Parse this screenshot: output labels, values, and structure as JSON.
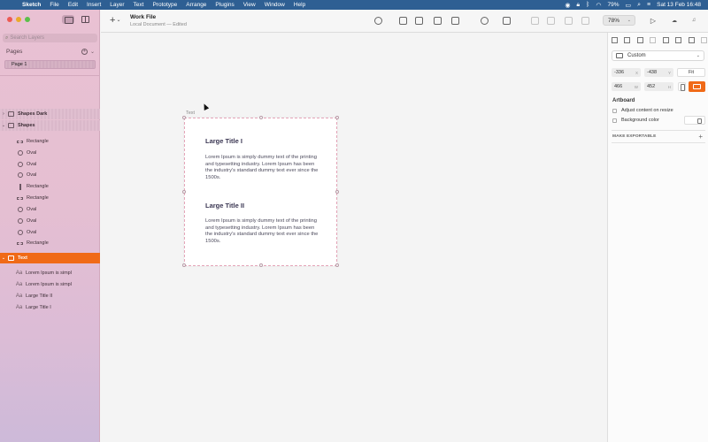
{
  "menubar": {
    "app": "Sketch",
    "items": [
      "File",
      "Edit",
      "Insert",
      "Layer",
      "Text",
      "Prototype",
      "Arrange",
      "Plugins",
      "View",
      "Window",
      "Help"
    ],
    "battery": "79%",
    "datetime": "Sat 13 Feb 16:48"
  },
  "sidebar": {
    "search_placeholder": "Search Layers",
    "pages_label": "Pages",
    "pages": [
      "Page 1"
    ],
    "layers": [
      {
        "label": "Shapes Dark",
        "kind": "group"
      },
      {
        "label": "Shapes",
        "kind": "group"
      },
      {
        "label": "Rectangle",
        "kind": "rect"
      },
      {
        "label": "Oval",
        "kind": "oval"
      },
      {
        "label": "Oval",
        "kind": "oval"
      },
      {
        "label": "Oval",
        "kind": "oval"
      },
      {
        "label": "Rectangle",
        "kind": "vbar"
      },
      {
        "label": "Rectangle",
        "kind": "rect"
      },
      {
        "label": "Oval",
        "kind": "oval"
      },
      {
        "label": "Oval",
        "kind": "oval"
      },
      {
        "label": "Oval",
        "kind": "oval"
      },
      {
        "label": "Rectangle",
        "kind": "rect"
      },
      {
        "label": "Text",
        "kind": "artboard-selected"
      },
      {
        "label": "Lorem Ipsum is simpl",
        "kind": "text"
      },
      {
        "label": "Lorem Ipsum is simpl",
        "kind": "text"
      },
      {
        "label": "Large Title II",
        "kind": "text"
      },
      {
        "label": "Large Title I",
        "kind": "text"
      }
    ]
  },
  "toolbar": {
    "doc_title": "Work File",
    "doc_subtitle": "Local Document — Edited",
    "zoom": "78%",
    "accent": "#f06a17"
  },
  "canvas": {
    "artboard_label": "Text",
    "title1": "Large Title I",
    "body1": "Lorem Ipsum is simply dummy text of the printing and typesetting industry. Lorem Ipsum has been the industry's standard dummy text ever since the 1500s.",
    "title2": "Large Title II",
    "body2": "Lorem Ipsum is simply dummy text of the printing and typesetting industry. Lorem Ipsum has been the industry's standard dummy text ever since the 1500s."
  },
  "inspector": {
    "preset": "Custom",
    "x": "-336",
    "x_unit": "X",
    "y": "-438",
    "y_unit": "Y",
    "fit_label": "Fit",
    "width": "466",
    "width_unit": "W",
    "height": "452",
    "height_unit": "H",
    "section_artboard": "Artboard",
    "adjust_label": "Adjust content on resize",
    "bg_label": "Background color",
    "make_exportable": "MAKE EXPORTABLE"
  }
}
